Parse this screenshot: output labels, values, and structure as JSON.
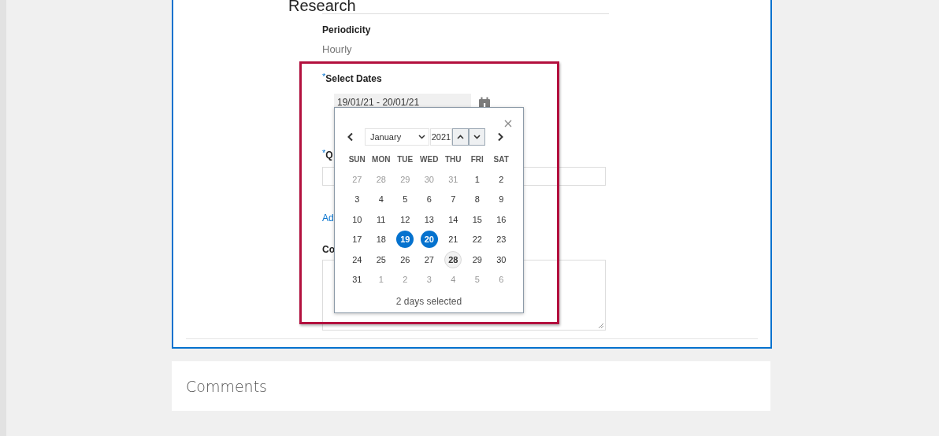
{
  "heading": "Research",
  "periodicity": {
    "label": "Periodicity",
    "value": "Hourly"
  },
  "select_dates": {
    "marker": "*",
    "label": "Select Dates",
    "value": "19/01/21 - 20/01/21"
  },
  "field_2": {
    "marker": "*",
    "label": "Q"
  },
  "link": {
    "label": "Ad"
  },
  "field_3": {
    "label": "Co"
  },
  "calendar": {
    "month": "January",
    "year": "2021",
    "weekdays": [
      "SUN",
      "MON",
      "TUE",
      "WED",
      "THU",
      "FRI",
      "SAT"
    ],
    "weeks": [
      [
        {
          "day": "27",
          "outside_month": true,
          "selected": false,
          "today": false
        },
        {
          "day": "28",
          "outside_month": true,
          "selected": false,
          "today": false
        },
        {
          "day": "29",
          "outside_month": true,
          "selected": false,
          "today": false
        },
        {
          "day": "30",
          "outside_month": true,
          "selected": false,
          "today": false
        },
        {
          "day": "31",
          "outside_month": true,
          "selected": false,
          "today": false
        },
        {
          "day": "1",
          "outside_month": false,
          "selected": false,
          "today": false
        },
        {
          "day": "2",
          "outside_month": false,
          "selected": false,
          "today": false
        }
      ],
      [
        {
          "day": "3",
          "outside_month": false,
          "selected": false,
          "today": false
        },
        {
          "day": "4",
          "outside_month": false,
          "selected": false,
          "today": false
        },
        {
          "day": "5",
          "outside_month": false,
          "selected": false,
          "today": false
        },
        {
          "day": "6",
          "outside_month": false,
          "selected": false,
          "today": false
        },
        {
          "day": "7",
          "outside_month": false,
          "selected": false,
          "today": false
        },
        {
          "day": "8",
          "outside_month": false,
          "selected": false,
          "today": false
        },
        {
          "day": "9",
          "outside_month": false,
          "selected": false,
          "today": false
        }
      ],
      [
        {
          "day": "10",
          "outside_month": false,
          "selected": false,
          "today": false
        },
        {
          "day": "11",
          "outside_month": false,
          "selected": false,
          "today": false
        },
        {
          "day": "12",
          "outside_month": false,
          "selected": false,
          "today": false
        },
        {
          "day": "13",
          "outside_month": false,
          "selected": false,
          "today": false
        },
        {
          "day": "14",
          "outside_month": false,
          "selected": false,
          "today": false
        },
        {
          "day": "15",
          "outside_month": false,
          "selected": false,
          "today": false
        },
        {
          "day": "16",
          "outside_month": false,
          "selected": false,
          "today": false
        }
      ],
      [
        {
          "day": "17",
          "outside_month": false,
          "selected": false,
          "today": false
        },
        {
          "day": "18",
          "outside_month": false,
          "selected": false,
          "today": false
        },
        {
          "day": "19",
          "outside_month": false,
          "selected": true,
          "today": false
        },
        {
          "day": "20",
          "outside_month": false,
          "selected": true,
          "today": false
        },
        {
          "day": "21",
          "outside_month": false,
          "selected": false,
          "today": false
        },
        {
          "day": "22",
          "outside_month": false,
          "selected": false,
          "today": false
        },
        {
          "day": "23",
          "outside_month": false,
          "selected": false,
          "today": false
        }
      ],
      [
        {
          "day": "24",
          "outside_month": false,
          "selected": false,
          "today": false
        },
        {
          "day": "25",
          "outside_month": false,
          "selected": false,
          "today": false
        },
        {
          "day": "26",
          "outside_month": false,
          "selected": false,
          "today": false
        },
        {
          "day": "27",
          "outside_month": false,
          "selected": false,
          "today": false
        },
        {
          "day": "28",
          "outside_month": false,
          "selected": false,
          "today": true
        },
        {
          "day": "29",
          "outside_month": false,
          "selected": false,
          "today": false
        },
        {
          "day": "30",
          "outside_month": false,
          "selected": false,
          "today": false
        }
      ],
      [
        {
          "day": "31",
          "outside_month": false,
          "selected": false,
          "today": false
        },
        {
          "day": "1",
          "outside_month": true,
          "selected": false,
          "today": false
        },
        {
          "day": "2",
          "outside_month": true,
          "selected": false,
          "today": false
        },
        {
          "day": "3",
          "outside_month": true,
          "selected": false,
          "today": false
        },
        {
          "day": "4",
          "outside_month": true,
          "selected": false,
          "today": false
        },
        {
          "day": "5",
          "outside_month": true,
          "selected": false,
          "today": false
        },
        {
          "day": "6",
          "outside_month": true,
          "selected": false,
          "today": false
        }
      ]
    ],
    "status": "2 days selected"
  },
  "comments": {
    "title": "Comments"
  }
}
